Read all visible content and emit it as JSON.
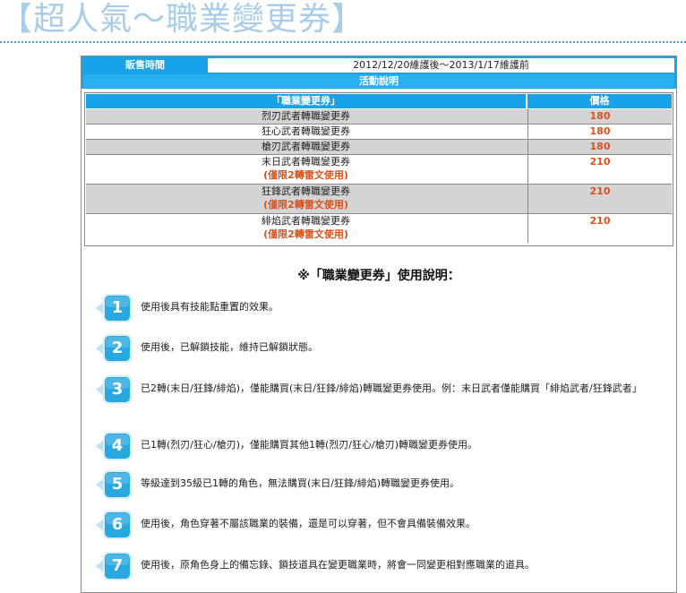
{
  "page_title": "【超人氣～職業變更券】",
  "sale": {
    "label": "販售時間",
    "value": "2012/12/20維護後～2013/1/17維護前"
  },
  "event_label": "活動說明",
  "table": {
    "headers": {
      "name": "「職業變更券」",
      "price": "價格"
    },
    "rows": [
      {
        "name": "烈刃武者轉職變更券",
        "note": "",
        "price": "180"
      },
      {
        "name": "狂心武者轉職變更券",
        "note": "",
        "price": "180"
      },
      {
        "name": "槍刃武者轉職變更券",
        "note": "",
        "price": "180"
      },
      {
        "name": "末日武者轉職變更券",
        "note": "(僅限2轉雷文使用)",
        "price": "210"
      },
      {
        "name": "狂鋒武者轉職變更券",
        "note": "(僅限2轉雷文使用)",
        "price": "210"
      },
      {
        "name": "緋焰武者轉職變更券",
        "note": "(僅限2轉雷文使用)",
        "price": "210"
      }
    ]
  },
  "usage": {
    "title": "※「職業變更券」使用說明：",
    "steps": [
      {
        "num": "1",
        "text": "使用後具有技能點重置的效果。"
      },
      {
        "num": "2",
        "text": "使用後，已解鎖技能，維持已解鎖狀態。"
      },
      {
        "num": "3",
        "text": "已2轉(末日/狂鋒/緋焰)，僅能購買(末日/狂鋒/緋焰)轉職變更券使用。例：末日武者僅能購買「緋焰武者/狂鋒武者」"
      },
      {
        "num": "4",
        "text": "已1轉(烈刃/狂心/槍刃)，僅能購買其他1轉(烈刃/狂心/槍刃)轉職變更券使用。"
      },
      {
        "num": "5",
        "text": "等級達到35級已1轉的角色，無法購買(末日/狂鋒/緋焰)轉職變更券使用。"
      },
      {
        "num": "6",
        "text": "使用後，角色穿著不屬該職業的裝備，還是可以穿著，但不會具備裝備效果。"
      },
      {
        "num": "7",
        "text": "使用後，原角色身上的備忘錄、鎖技道具在變更職業時，將會一同變更相對應職業的道具。"
      }
    ]
  },
  "colors": {
    "header_blue": "#17a2e9",
    "price_orange": "#d9531e",
    "badge_blue": "#29a8e0",
    "title_blue": "#a9cde8"
  }
}
